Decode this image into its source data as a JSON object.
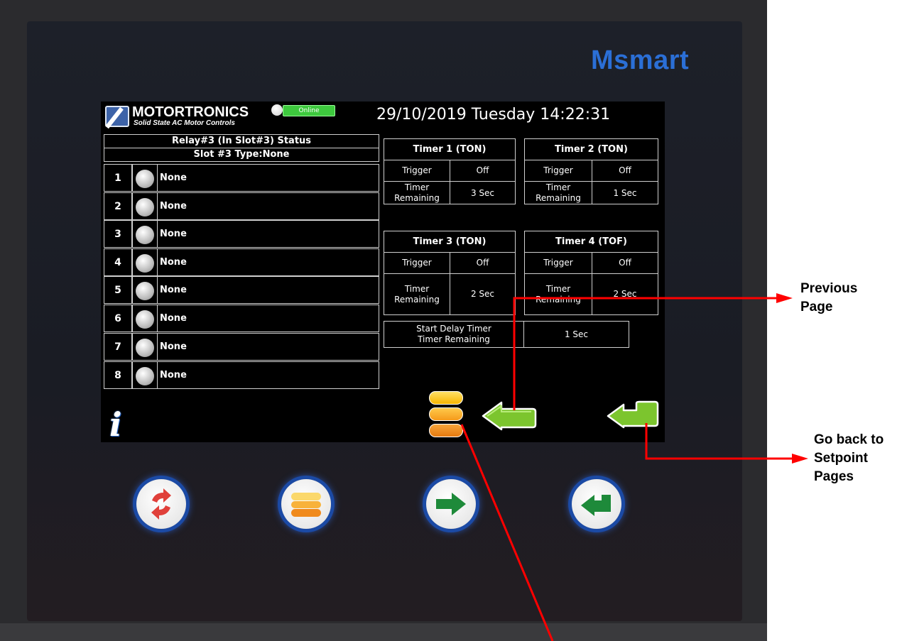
{
  "device": {
    "brand": "Msmart"
  },
  "header": {
    "logo_title": "MOTORTRONICS",
    "logo_subtitle": "Solid State AC Motor Controls",
    "status": "Online",
    "datetime": "29/10/2019 Tuesday 14:22:31"
  },
  "relay_panel": {
    "title": "Relay#3 (In Slot#3) Status",
    "subtitle": "Slot #3 Type:None",
    "rows": [
      {
        "num": "1",
        "label": "None"
      },
      {
        "num": "2",
        "label": "None"
      },
      {
        "num": "3",
        "label": "None"
      },
      {
        "num": "4",
        "label": "None"
      },
      {
        "num": "5",
        "label": "None"
      },
      {
        "num": "6",
        "label": "None"
      },
      {
        "num": "7",
        "label": "None"
      },
      {
        "num": "8",
        "label": "None"
      }
    ]
  },
  "timers": [
    {
      "title": "Timer 1 (TON)",
      "trigger_label": "Trigger",
      "trigger_value": "Off",
      "remaining_label": "Timer Remaining",
      "remaining_value": "3 Sec"
    },
    {
      "title": "Timer 2 (TON)",
      "trigger_label": "Trigger",
      "trigger_value": "Off",
      "remaining_label": "Timer Remaining",
      "remaining_value": "1 Sec"
    },
    {
      "title": "Timer 3 (TON)",
      "trigger_label": "Trigger",
      "trigger_value": "Off",
      "remaining_label": "Timer Remaining",
      "remaining_value": "2 Sec"
    },
    {
      "title": "Timer 4 (TOF)",
      "trigger_label": "Trigger",
      "trigger_value": "Off",
      "remaining_label": "Timer Remaining",
      "remaining_value": "2 Sec"
    }
  ],
  "start_delay": {
    "label_line1": "Start Delay Timer",
    "label_line2": "Timer Remaining",
    "value": "1 Sec"
  },
  "screen_icons": [
    "info-icon",
    "menu-icon",
    "previous-page-arrow-icon",
    "back-to-setpoint-arrow-icon"
  ],
  "hardware_buttons": [
    "refresh-icon",
    "menu-icon",
    "forward-arrow-icon",
    "back-arrow-icon"
  ],
  "annotations": {
    "previous_page_line1": "Previous",
    "previous_page_line2": "Page",
    "go_back_line1": "Go back to",
    "go_back_line2": "Setpoint",
    "go_back_line3": "Pages"
  },
  "colors": {
    "annotation_arrow": "#ff0000",
    "online_green": "#3ec93e",
    "brand_blue": "#2b6fd6",
    "icon_green": "#7bc42c",
    "menu_orange": "#f59a1b"
  }
}
